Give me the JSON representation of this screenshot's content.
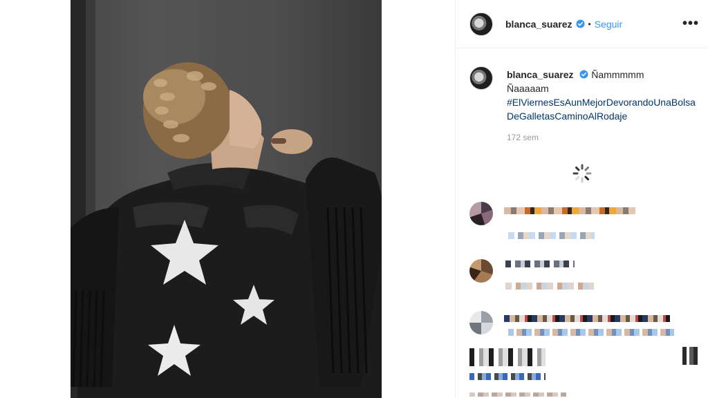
{
  "post": {
    "username": "blanca_suarez",
    "follow_label": "Seguir",
    "separator": "•",
    "more_label": "•••"
  },
  "caption": {
    "username": "blanca_suarez",
    "line1": "Ñammmmm",
    "line2": "Ñaaaaam",
    "hashtag": "#ElViernesEsAunMejorDevorandoUnaBolsaDeGalletasCaminoAlRodaje",
    "time": "172 sem"
  },
  "icons": {
    "verified": "verified-badge-icon",
    "loading": "loading-spinner-icon",
    "more": "more-options-icon"
  },
  "colors": {
    "link": "#3897f0",
    "hashtag": "#003569",
    "verified": "#3897f0",
    "muted": "#999999"
  }
}
